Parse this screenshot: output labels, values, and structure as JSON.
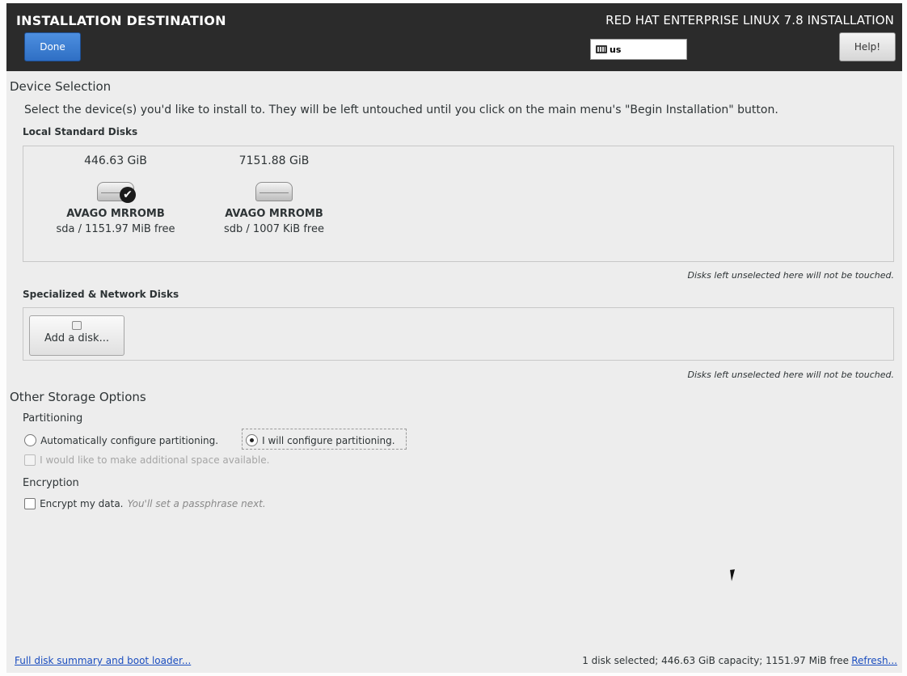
{
  "header": {
    "title": "INSTALLATION DESTINATION",
    "done_label": "Done",
    "product": "RED HAT ENTERPRISE LINUX 7.8 INSTALLATION",
    "keyboard_layout": "us",
    "help_label": "Help!"
  },
  "device_selection": {
    "heading": "Device Selection",
    "description": "Select the device(s) you'd like to install to.  They will be left untouched until you click on the main menu's \"Begin Installation\" button.",
    "local_heading": "Local Standard Disks",
    "disks": [
      {
        "size": "446.63 GiB",
        "name": "AVAGO MRROMB",
        "detail": "sda / 1151.97 MiB free",
        "selected": true
      },
      {
        "size": "7151.88 GiB",
        "name": "AVAGO MRROMB",
        "detail": "sdb / 1007 KiB free",
        "selected": false
      }
    ],
    "local_note": "Disks left unselected here will not be touched.",
    "specialized_heading": "Specialized & Network Disks",
    "add_disk_label": "Add a disk...",
    "specialized_note": "Disks left unselected here will not be touched."
  },
  "other_storage": {
    "heading": "Other Storage Options",
    "partitioning_heading": "Partitioning",
    "auto_label": "Automatically configure partitioning.",
    "manual_label": "I will configure partitioning.",
    "selected_option": "I will configure partitioning.",
    "space_label": "I would like to make additional space available.",
    "encryption_heading": "Encryption",
    "encrypt_label": "Encrypt my data.",
    "encrypt_hint": "You'll set a passphrase next."
  },
  "footer": {
    "summary_link": "Full disk summary and boot loader...",
    "status": "1 disk selected; 446.63 GiB capacity; 1151.97 MiB free",
    "refresh_link": "Refresh..."
  }
}
